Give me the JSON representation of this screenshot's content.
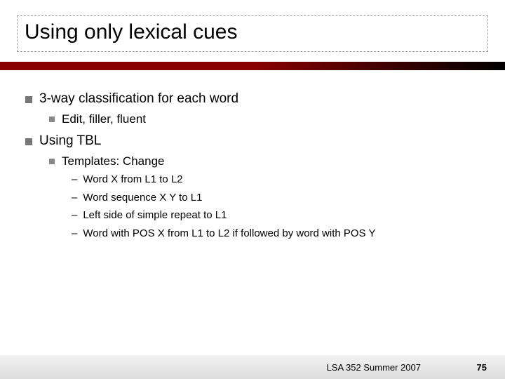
{
  "title": "Using only lexical cues",
  "bullets": {
    "b1": "3-way classification for each word",
    "b1a": "Edit, filler, fluent",
    "b2": "Using TBL",
    "b2a": "Templates: Change",
    "b2a1": "Word X from L1 to L2",
    "b2a2": "Word sequence X Y to L1",
    "b2a3": "Left side of simple repeat to L1",
    "b2a4": "Word with POS X from L1 to L2 if followed by word with POS Y"
  },
  "footer": "LSA 352 Summer 2007",
  "page_number": "75"
}
